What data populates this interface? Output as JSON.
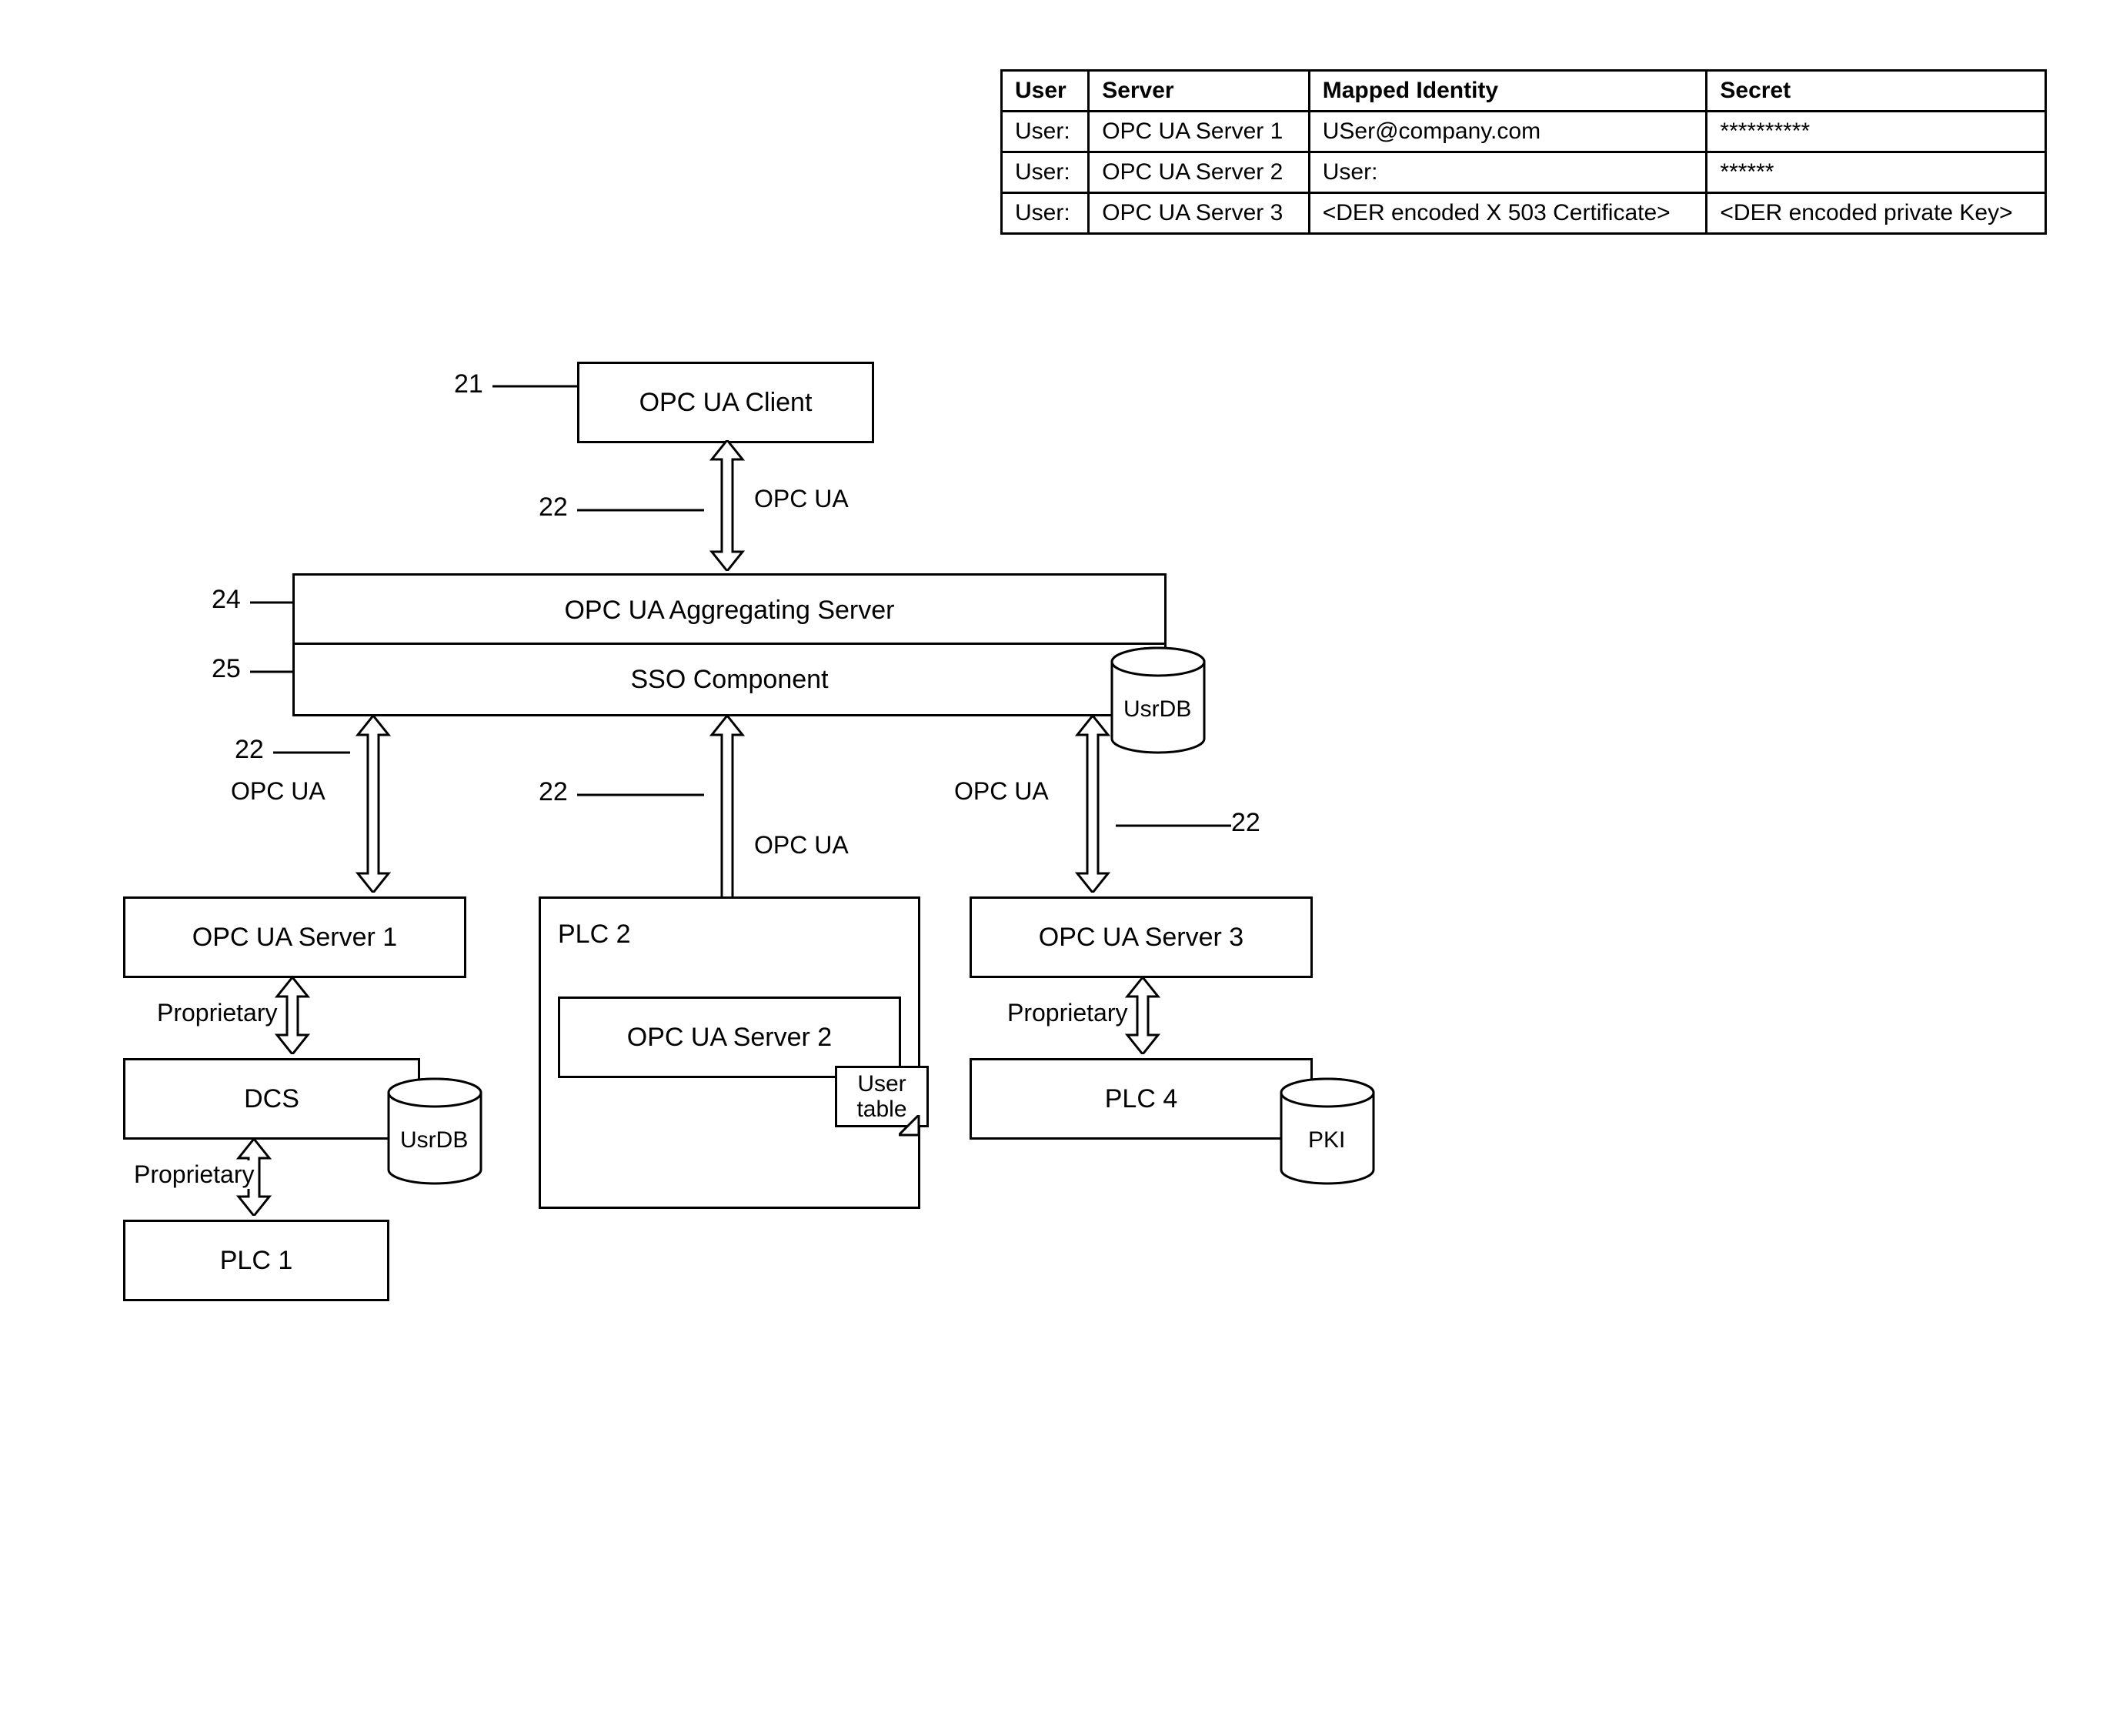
{
  "refs": {
    "r21": "21",
    "r22_top": "22",
    "r24": "24",
    "r25": "25",
    "r22_left": "22",
    "r22_mid": "22",
    "r22_right": "22"
  },
  "boxes": {
    "client": "OPC UA Client",
    "agg": "OPC UA Aggregating Server",
    "sso": "SSO Component",
    "server1": "OPC UA Server 1",
    "server2": "OPC UA Server 2",
    "server3": "OPC UA Server 3",
    "plc2_label": "PLC 2",
    "dcs": "DCS",
    "plc1": "PLC 1",
    "plc4": "PLC 4"
  },
  "conn": {
    "opcua": "OPC UA",
    "proprietary": "Proprietary"
  },
  "db": {
    "usrdb": "UsrDB",
    "pki": "PKI",
    "user_table": "User\ntable"
  },
  "table": {
    "headers": [
      "User",
      "Server",
      "Mapped Identity",
      "Secret"
    ],
    "rows": [
      [
        "User:",
        "OPC UA Server 1",
        "USer@company.com",
        "**********"
      ],
      [
        "User:",
        "OPC UA Server 2",
        "User:",
        "******"
      ],
      [
        "User:",
        "OPC UA Server 3",
        "<DER encoded X 503 Certificate>",
        "<DER encoded private Key>"
      ]
    ]
  },
  "chart_data": {
    "type": "diagram",
    "description": "OPC UA architecture: Client(21) connects via OPC UA(22) to Aggregating Server(24) with SSO Component(25) and UsrDB. Aggregating server connects via OPC UA(22) to three OPC UA Servers. Server1 -> DCS (with UsrDB) -> PLC1 via Proprietary links. Server2 embedded in PLC2 with User table. Server3 -> PLC4 (with PKI) via Proprietary. Identity mapping table at top right.",
    "nodes": [
      {
        "id": 21,
        "name": "OPC UA Client"
      },
      {
        "id": 24,
        "name": "OPC UA Aggregating Server"
      },
      {
        "id": 25,
        "name": "SSO Component",
        "attached": "UsrDB"
      },
      {
        "id": "s1",
        "name": "OPC UA Server 1"
      },
      {
        "id": "s2",
        "name": "OPC UA Server 2",
        "container": "PLC 2",
        "attached": "User table"
      },
      {
        "id": "s3",
        "name": "OPC UA Server 3"
      },
      {
        "id": "dcs",
        "name": "DCS",
        "attached": "UsrDB"
      },
      {
        "id": "plc1",
        "name": "PLC 1"
      },
      {
        "id": "plc4",
        "name": "PLC 4",
        "attached": "PKI"
      }
    ],
    "edges": [
      {
        "from": 21,
        "to": 24,
        "label": "OPC UA",
        "bidir": true,
        "id": 22
      },
      {
        "from": 25,
        "to": "s1",
        "label": "OPC UA",
        "bidir": true,
        "id": 22
      },
      {
        "from": 25,
        "to": "s2",
        "label": "OPC UA",
        "bidir": true,
        "id": 22
      },
      {
        "from": 25,
        "to": "s3",
        "label": "OPC UA",
        "bidir": true,
        "id": 22
      },
      {
        "from": "s1",
        "to": "dcs",
        "label": "Proprietary",
        "bidir": true
      },
      {
        "from": "dcs",
        "to": "plc1",
        "label": "Proprietary",
        "bidir": true
      },
      {
        "from": "s3",
        "to": "plc4",
        "label": "Proprietary",
        "bidir": true
      }
    ]
  }
}
